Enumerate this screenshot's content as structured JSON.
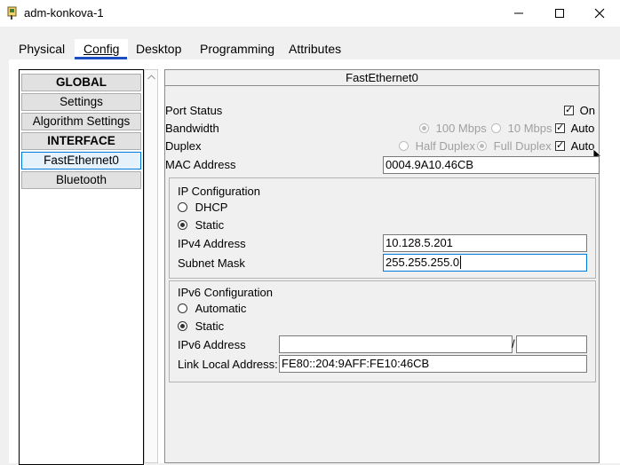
{
  "window": {
    "title": "adm-konkova-1",
    "icons": [
      "app-icon",
      "minimize-icon",
      "maximize-icon",
      "close-icon"
    ]
  },
  "tabs": [
    "Physical",
    "Config",
    "Desktop",
    "Programming",
    "Attributes"
  ],
  "nav": {
    "global": "GLOBAL",
    "settings": "Settings",
    "algorithm": "Algorithm Settings",
    "interface": "INTERFACE",
    "fastethernet": "FastEthernet0",
    "bluetooth": "Bluetooth"
  },
  "panel": {
    "header": "FastEthernet0",
    "port_status_label": "Port Status",
    "port_status_on_label": "On",
    "port_status_on": true,
    "bandwidth_label": "Bandwidth",
    "bw_100": "100 Mbps",
    "bw_10": "10 Mbps",
    "bw_auto": "Auto",
    "duplex_label": "Duplex",
    "half_duplex": "Half Duplex",
    "full_duplex": "Full Duplex",
    "duplex_auto": "Auto",
    "mac_label": "MAC Address",
    "mac_value": "0004.9A10.46CB"
  },
  "ipv4": {
    "title": "IP Configuration",
    "dhcp": "DHCP",
    "static": "Static",
    "selected": "Static",
    "address_label": "IPv4 Address",
    "address_value": "10.128.5.201",
    "mask_label": "Subnet Mask",
    "mask_value": "255.255.255.0"
  },
  "ipv6": {
    "title": "IPv6 Configuration",
    "automatic": "Automatic",
    "static": "Static",
    "selected": "Static",
    "address_label": "IPv6 Address",
    "address_value": "",
    "prefix_value": "",
    "prefix_sep": "/",
    "link_local_label": "Link Local Address:",
    "link_local_value": "FE80::204:9AFF:FE10:46CB"
  },
  "colors": {
    "accent": "#0078d7",
    "tab_underline": "#1d4ec0"
  }
}
